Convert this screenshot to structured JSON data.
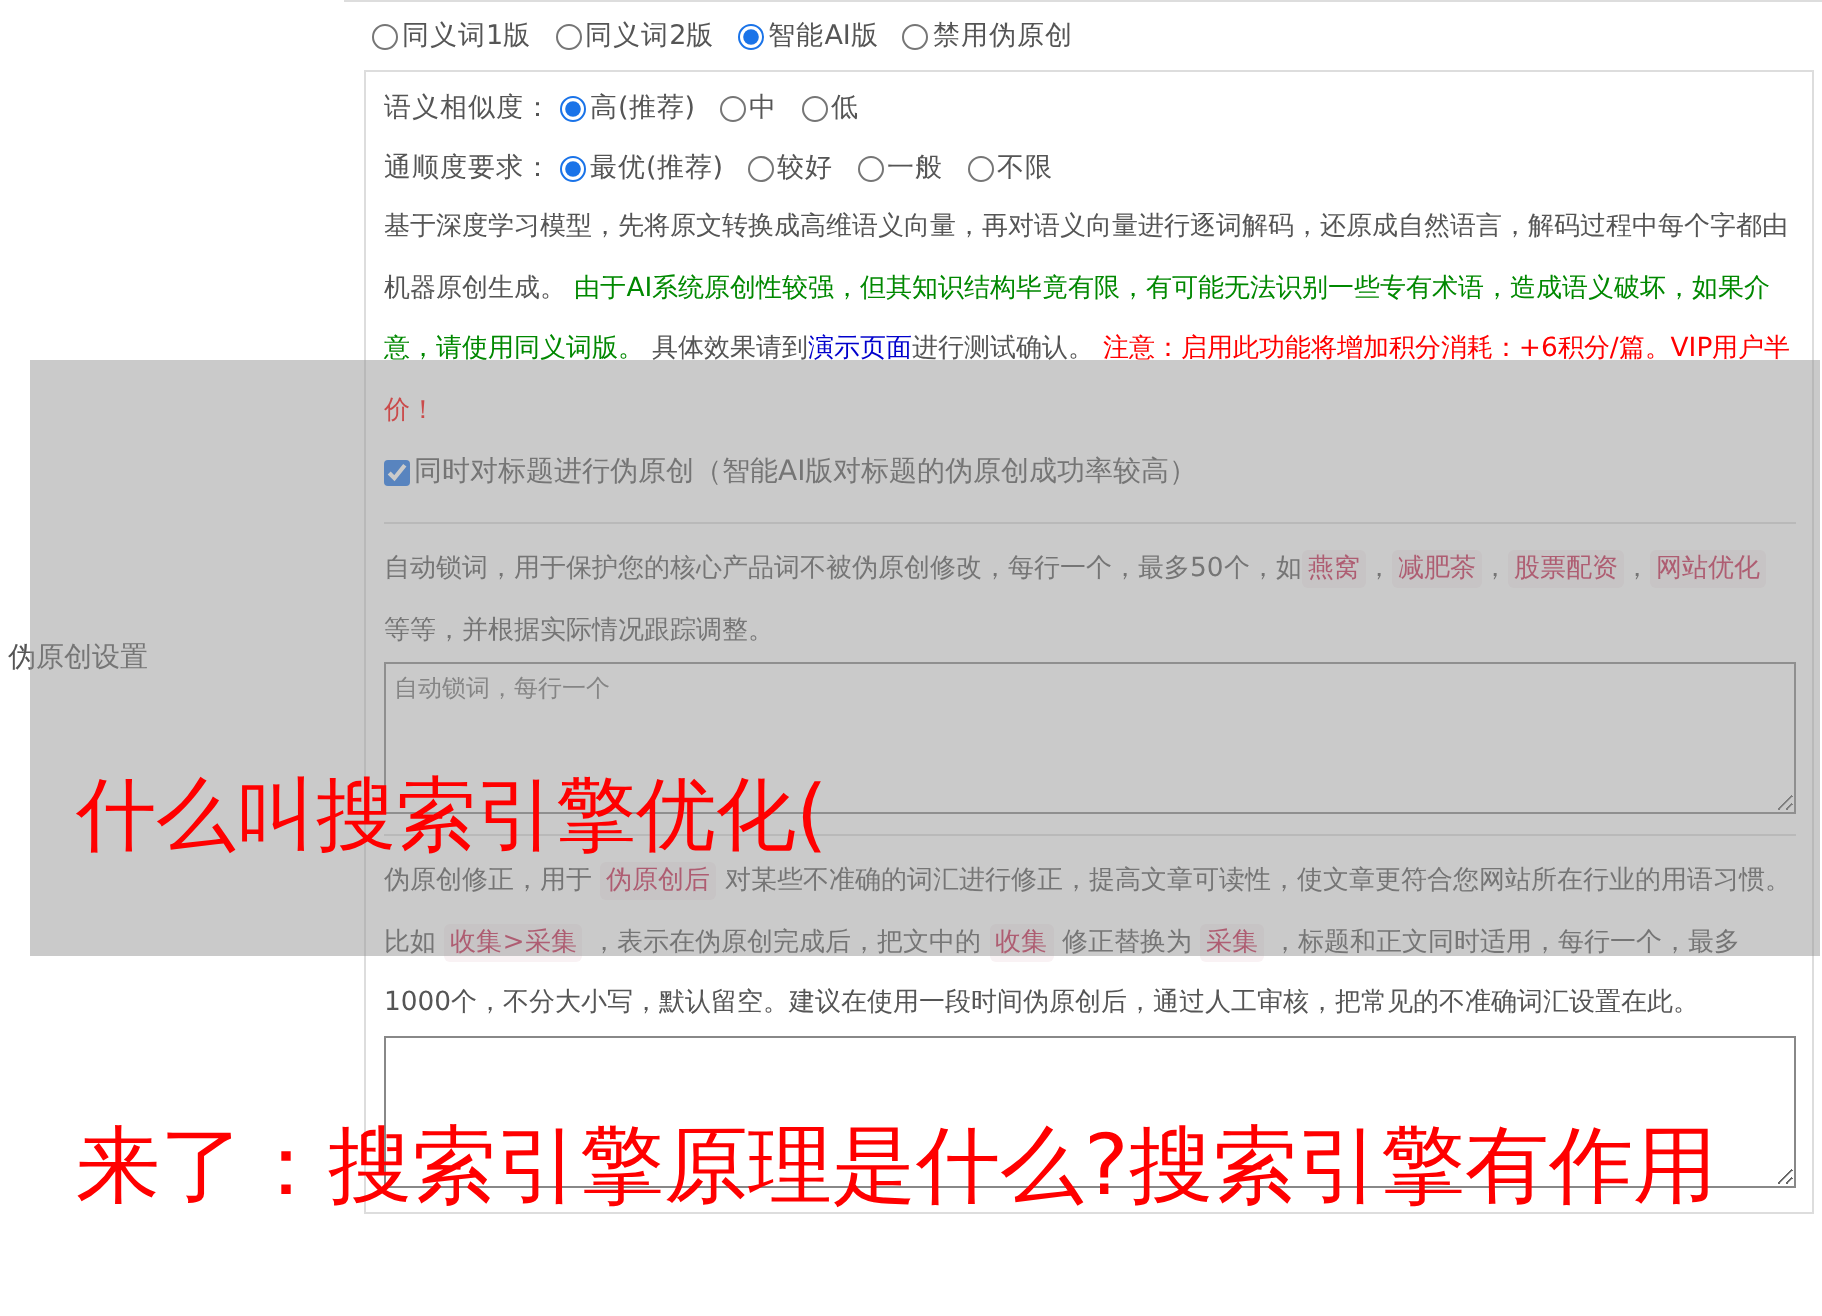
{
  "section_label": "伪原创设置",
  "version_options": [
    {
      "label": "同义词1版",
      "selected": false
    },
    {
      "label": "同义词2版",
      "selected": false
    },
    {
      "label": "智能AI版",
      "selected": true
    },
    {
      "label": "禁用伪原创",
      "selected": false
    }
  ],
  "similarity": {
    "label": "语义相似度：",
    "options": [
      {
        "label": "高(推荐)",
        "selected": true
      },
      {
        "label": "中",
        "selected": false
      },
      {
        "label": "低",
        "selected": false
      }
    ]
  },
  "fluency": {
    "label": "通顺度要求：",
    "options": [
      {
        "label": "最优(推荐)",
        "selected": true
      },
      {
        "label": "较好",
        "selected": false
      },
      {
        "label": "一般",
        "selected": false
      },
      {
        "label": "不限",
        "selected": false
      }
    ]
  },
  "description": [
    {
      "kind": "plain",
      "text": "基于深度学习模型，先将原文转换成高维语义向量，再对语义向量进行逐词解码，还原成自然语言，解码过程中每个字都由机器原创生成。 "
    },
    {
      "kind": "notice",
      "text": "由于AI系统原创性较强，但其知识结构毕竟有限，有可能无法识别一些专有术语，造成语义破坏，如果介意，请使用同义词版。"
    },
    {
      "kind": "plain",
      "text": " 具体效果请到"
    },
    {
      "kind": "link",
      "text": "演示页面"
    },
    {
      "kind": "plain",
      "text": "进行测试确认。 "
    },
    {
      "kind": "warning",
      "text": "注意：启用此功能将增加积分消耗：+6积分/篇。VIP用户半价！"
    }
  ],
  "title_option": {
    "label": "同时对标题进行伪原创（智能AI版对标题的伪原创成功率较高）",
    "checked": true
  },
  "lock_words": {
    "text": [
      {
        "kind": "plain",
        "text": "自动锁词，用于保护您的核心产品词不被伪原创修改，每行一个，最多50个，如"
      },
      {
        "kind": "tag",
        "text": "燕窝"
      },
      {
        "kind": "plain",
        "text": "，"
      },
      {
        "kind": "tag",
        "text": "减肥茶"
      },
      {
        "kind": "plain",
        "text": "，"
      },
      {
        "kind": "tag",
        "text": "股票配资"
      },
      {
        "kind": "plain",
        "text": "，"
      },
      {
        "kind": "tag",
        "text": "网站优化"
      },
      {
        "kind": "plain",
        "text": " 等等，并根据实际情况跟踪调整。"
      }
    ],
    "placeholder": "自动锁词，每行一个"
  },
  "correction": {
    "text": [
      {
        "kind": "plain",
        "text": "伪原创修正，用于 "
      },
      {
        "kind": "tag",
        "text": "伪原创后"
      },
      {
        "kind": "plain",
        "text": " 对某些不准确的词汇进行修正，提高文章可读性，使文章更符合您网站所在行业的用语习惯。比如 "
      },
      {
        "kind": "tag",
        "text": "收集>采集"
      },
      {
        "kind": "plain",
        "text": " ，表示在伪原创完成后，把文中的 "
      },
      {
        "kind": "tag",
        "text": "收集"
      },
      {
        "kind": "plain",
        "text": " 修正替换为 "
      },
      {
        "kind": "tag",
        "text": "采集"
      },
      {
        "kind": "plain",
        "text": " ，标题和正文同时适用，每行一个，最多1000个，不分大小写，默认留空。建议在使用一段时间伪原创后，通过人工审核，把常见的不准确词汇设置在此。"
      }
    ]
  },
  "overlay_captions": [
    "什么叫搜索引擎优化(",
    "来了：搜索引擎原理是什么?搜索引擎有作用"
  ]
}
